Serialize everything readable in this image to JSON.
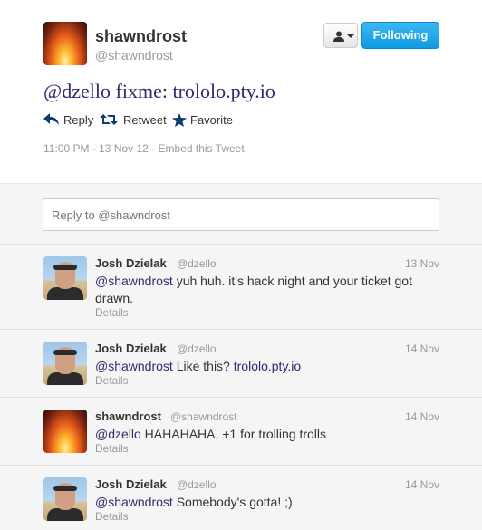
{
  "tweet": {
    "fullname": "shawndrost",
    "handle": "@shawndrost",
    "follow_label": "Following",
    "text_mention": "@dzello",
    "text_body": " fixme: ",
    "text_url": "trololo.pty.io",
    "actions": {
      "reply": "Reply",
      "retweet": "Retweet",
      "favorite": "Favorite"
    },
    "timestamp": "11:00 PM - 13 Nov 12",
    "separator": " · ",
    "embed": "Embed this Tweet"
  },
  "reply_box": {
    "placeholder": "Reply to @shawndrost"
  },
  "replies": [
    {
      "name": "Josh Dzielak",
      "handle": "@dzello",
      "date": "13 Nov",
      "mention": "@shawndrost",
      "text": " yuh huh. it's hack night and your ticket got drawn.",
      "url": "",
      "details": "Details"
    },
    {
      "name": "Josh Dzielak",
      "handle": "@dzello",
      "date": "14 Nov",
      "mention": "@shawndrost",
      "text": " Like this? ",
      "url": "trololo.pty.io",
      "details": "Details"
    },
    {
      "name": "shawndrost",
      "handle": "@shawndrost",
      "date": "14 Nov",
      "mention": "@dzello",
      "text": " HAHAHAHA, +1 for trolling trolls",
      "url": "",
      "details": "Details"
    },
    {
      "name": "Josh Dzielak",
      "handle": "@dzello",
      "date": "14 Nov",
      "mention": "@shawndrost",
      "text": " Somebody's gotta! ;)",
      "url": "",
      "details": "Details"
    }
  ],
  "colors": {
    "follow_blue": "#1da1f2",
    "link": "#2c2c6e",
    "muted": "#999999",
    "bg_gray": "#f5f5f5"
  }
}
